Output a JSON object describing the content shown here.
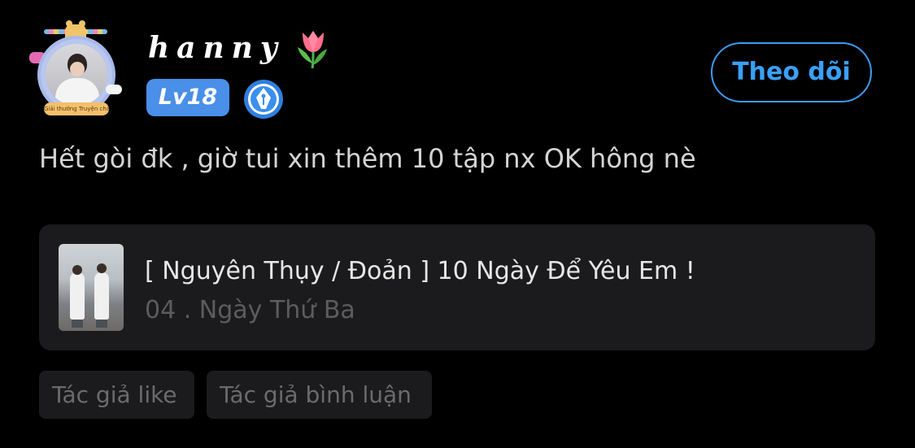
{
  "user": {
    "name": "𝒽𝒶𝓃𝓃𝓎",
    "name_plain": "hanny",
    "level": "Lv18",
    "avatar_banner": "Giải thưởng Truyện chất",
    "name_decoration_icon": "tulip-icon",
    "badge_icon": "pen-nib-badge-icon"
  },
  "actions": {
    "follow_label": "Theo dõi"
  },
  "comment": {
    "text": "Hết gòi đk , giờ tui xin thêm 10 tập nx OK hông nè"
  },
  "quoted_story": {
    "title": "[ Nguyên Thụy / Đoản ] 10 Ngày Để Yêu Em !",
    "chapter": "04 . Ngày Thứ Ba"
  },
  "tags": [
    "Tác giả like",
    "Tác giả bình luận"
  ],
  "colors": {
    "background": "#000000",
    "accent": "#3aa0f8",
    "level_badge": "#4a8fe8",
    "card": "#1b1b1d"
  }
}
